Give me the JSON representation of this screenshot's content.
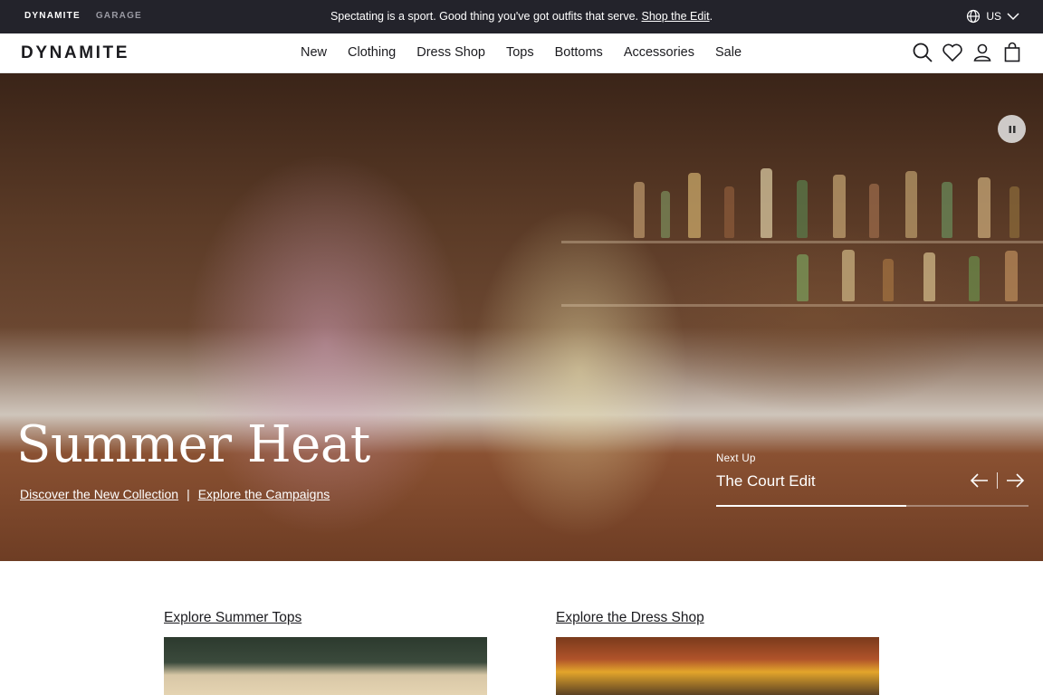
{
  "topbar": {
    "brands": [
      "DYNAMITE",
      "GARAGE"
    ],
    "promo_text": "Spectating is a sport. Good thing you've got outfits that serve.",
    "promo_link": "Shop the Edit",
    "promo_end": ".",
    "region": "US"
  },
  "header": {
    "logo": "DYNAMITE",
    "nav": [
      "New",
      "Clothing",
      "Dress Shop",
      "Tops",
      "Bottoms",
      "Accessories",
      "Sale"
    ],
    "icons": [
      "search-icon",
      "heart-icon",
      "account-icon",
      "bag-icon"
    ]
  },
  "hero": {
    "title": "Summer Heat",
    "link_1": "Discover the New Collection",
    "separator": "|",
    "link_2": "Explore the Campaigns",
    "next_up_label": "Next Up",
    "next_up_title": "The Court Edit",
    "progress": 0.61
  },
  "sections": {
    "card_1_link": "Explore Summer Tops",
    "card_2_link": "Explore the Dress Shop"
  },
  "colors": {
    "topbar_bg": "#23232b",
    "text": "#1b1b1f"
  }
}
